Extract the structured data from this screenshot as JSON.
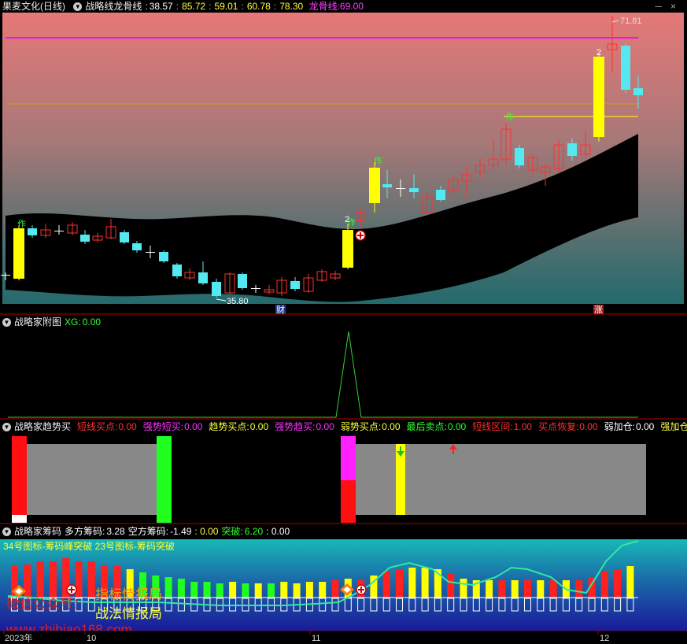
{
  "title_bar": {
    "stock_name": "果麦文化(日线)",
    "indicator_name": "战略线龙骨线",
    "values": [
      "38.57",
      "85.72",
      "59.01",
      "60.78",
      "78.30"
    ],
    "dragon_label": "龙骨线:",
    "dragon_value": "69.00",
    "minimize_icon": "─",
    "close_icon": "×"
  },
  "main_panel": {
    "price_high_label": "71.81",
    "price_low_label": "35.80",
    "zuo_labels": [
      "作",
      "作",
      "作",
      "作"
    ],
    "num_labels": [
      "2",
      "2"
    ],
    "cai_label": "财",
    "zhang_label": "涨",
    "colors": {
      "bg_top": "#e67878",
      "bg_bottom": "#2a6b6e",
      "up": "#ff3030",
      "down": "#54e8f0",
      "yellow": "#ffff00",
      "magenta": "#e020e0"
    }
  },
  "fuzhu_panel": {
    "name": "战略家附图",
    "xg_label": "XG:",
    "xg_value": "0.00"
  },
  "trend_panel": {
    "name": "战略家趋势买",
    "items": [
      {
        "label": "短线买点:",
        "value": "0.00",
        "color": "#ff3030"
      },
      {
        "label": "强势短买:",
        "value": "0.00",
        "color": "#ff30ff"
      },
      {
        "label": "趋势买点:",
        "value": "0.00",
        "color": "#ffff40"
      },
      {
        "label": "强势趋买:",
        "value": "0.00",
        "color": "#ff30ff"
      },
      {
        "label": "弱势买点:",
        "value": "0.00",
        "color": "#ffff40"
      },
      {
        "label": "最后卖点:",
        "value": "0.00",
        "color": "#30ff30"
      },
      {
        "label": "短线区间:",
        "value": "1.00",
        "color": "#ff3030"
      },
      {
        "label": "买点恢复:",
        "value": "0.00",
        "color": "#ff3030"
      },
      {
        "label": "弱加仓:",
        "value": "0.00",
        "color": "#ffffff"
      },
      {
        "label": "强加仓:",
        "value": "",
        "color": "#ffff40"
      }
    ]
  },
  "chips_panel": {
    "name": "战略家筹码",
    "duofang_label": "多方筹码:",
    "duofang_value": "3.28",
    "kongfang_label": "空方筹码:",
    "kongfang_value": "-1.49",
    "extra_value": ": 0.00",
    "tupo_label": "突破:",
    "tupo_value": "6.20",
    "last_value": ": 0.00",
    "legend_text": "34号图标-筹码峰突破 23号图标-筹码突破"
  },
  "axis": {
    "labels": [
      "2023年",
      "10",
      "11",
      "12"
    ]
  },
  "watermarks": {
    "wechat": "微信公众号：",
    "zhibiao": "指标情报局",
    "zhanfa": "战法情报局",
    "site": "www.zhibiao168.com"
  }
}
